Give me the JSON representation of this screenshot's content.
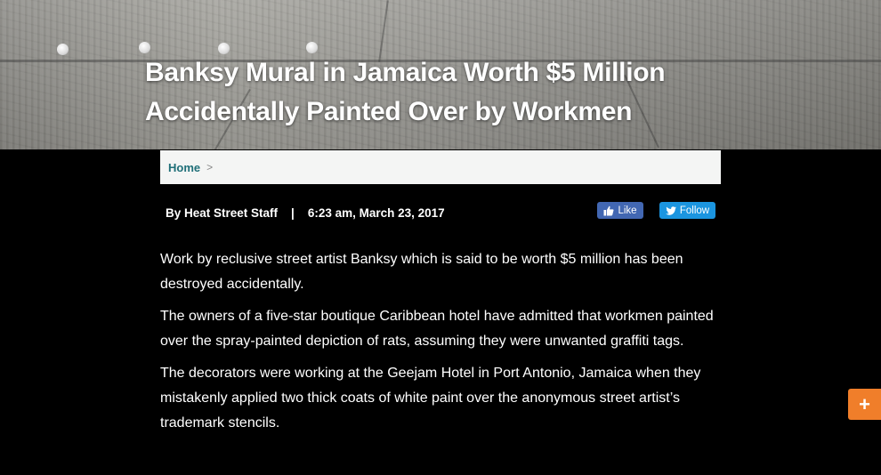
{
  "article": {
    "title": "Banksy Mural in Jamaica Worth $5 Million Accidentally Painted Over by Workmen",
    "author": "By Heat Street Staff",
    "divider": "|",
    "timestamp": "6:23 am, March 23, 2017",
    "paragraphs": [
      "Work by reclusive street artist Banksy which is said to be worth $5 million has been destroyed accidentally.",
      "The owners of a five-star boutique Caribbean hotel have admitted that workmen painted over the spray-painted depiction of rats, assuming they were unwanted graffiti tags.",
      "The decorators were working at the Geejam Hotel in Port Antonio, Jamaica when they mistakenly applied two thick coats of white paint over the anonymous street artist’s trademark stencils."
    ]
  },
  "breadcrumb": {
    "home_label": "Home",
    "separator": ">"
  },
  "social": {
    "like_label": "Like",
    "follow_label": "Follow",
    "like_icon": "thumbs-up-icon",
    "follow_icon": "twitter-bird-icon"
  },
  "floating_button": {
    "label": "+",
    "color": "#f07e2a"
  },
  "colors": {
    "background": "#000000",
    "link": "#1f6f78",
    "facebook": "#4267b2",
    "twitter": "#1b95e0"
  }
}
